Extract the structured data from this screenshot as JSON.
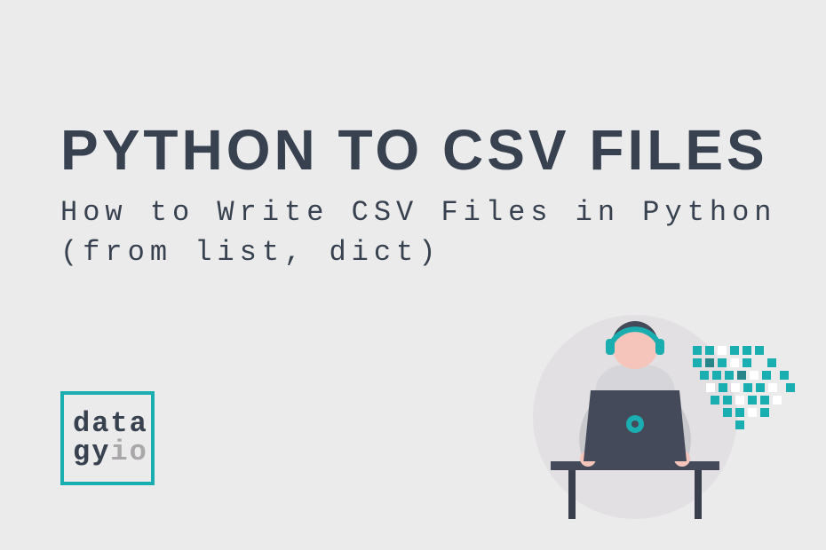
{
  "heading": "PYTHON TO CSV FILES",
  "subheading": "How to Write CSV Files in Python (from list, dict)",
  "logo": {
    "line1": "data",
    "line2_left": "gy",
    "line2_right": "io"
  },
  "colors": {
    "background": "#ecebec",
    "text": "#37414f",
    "accent": "#1aaeb0",
    "muted": "#a9a7aa"
  }
}
